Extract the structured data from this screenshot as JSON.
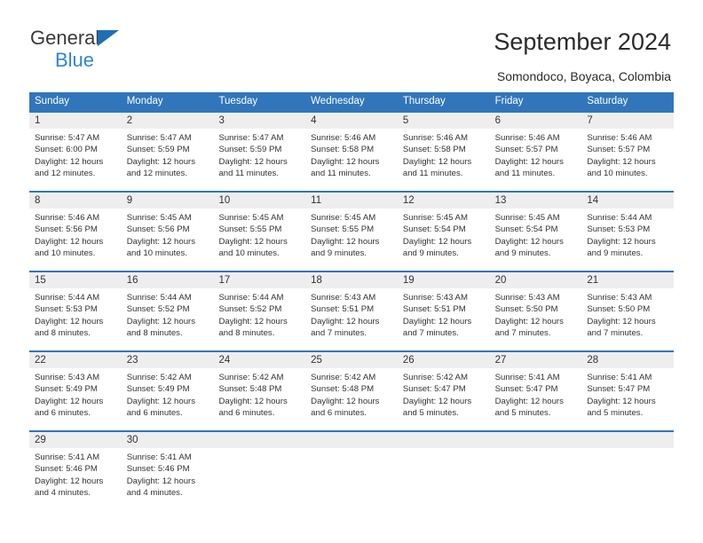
{
  "brand": {
    "name_top": "General",
    "name_bottom": "Blue",
    "accent_color": "#2f86d6",
    "triangle_color": "#1f6fb5"
  },
  "header": {
    "title": "September 2024",
    "subtitle": "Somondoco, Boyaca, Colombia"
  },
  "calendar": {
    "header_bg": "#3176ba",
    "row_border_color": "#3176ba",
    "day_number_bg": "#eeeeee",
    "weekdays": [
      "Sunday",
      "Monday",
      "Tuesday",
      "Wednesday",
      "Thursday",
      "Friday",
      "Saturday"
    ],
    "weeks": [
      [
        {
          "day": "1",
          "sunrise": "Sunrise: 5:47 AM",
          "sunset": "Sunset: 6:00 PM",
          "daylight_1": "Daylight: 12 hours",
          "daylight_2": "and 12 minutes."
        },
        {
          "day": "2",
          "sunrise": "Sunrise: 5:47 AM",
          "sunset": "Sunset: 5:59 PM",
          "daylight_1": "Daylight: 12 hours",
          "daylight_2": "and 12 minutes."
        },
        {
          "day": "3",
          "sunrise": "Sunrise: 5:47 AM",
          "sunset": "Sunset: 5:59 PM",
          "daylight_1": "Daylight: 12 hours",
          "daylight_2": "and 11 minutes."
        },
        {
          "day": "4",
          "sunrise": "Sunrise: 5:46 AM",
          "sunset": "Sunset: 5:58 PM",
          "daylight_1": "Daylight: 12 hours",
          "daylight_2": "and 11 minutes."
        },
        {
          "day": "5",
          "sunrise": "Sunrise: 5:46 AM",
          "sunset": "Sunset: 5:58 PM",
          "daylight_1": "Daylight: 12 hours",
          "daylight_2": "and 11 minutes."
        },
        {
          "day": "6",
          "sunrise": "Sunrise: 5:46 AM",
          "sunset": "Sunset: 5:57 PM",
          "daylight_1": "Daylight: 12 hours",
          "daylight_2": "and 11 minutes."
        },
        {
          "day": "7",
          "sunrise": "Sunrise: 5:46 AM",
          "sunset": "Sunset: 5:57 PM",
          "daylight_1": "Daylight: 12 hours",
          "daylight_2": "and 10 minutes."
        }
      ],
      [
        {
          "day": "8",
          "sunrise": "Sunrise: 5:46 AM",
          "sunset": "Sunset: 5:56 PM",
          "daylight_1": "Daylight: 12 hours",
          "daylight_2": "and 10 minutes."
        },
        {
          "day": "9",
          "sunrise": "Sunrise: 5:45 AM",
          "sunset": "Sunset: 5:56 PM",
          "daylight_1": "Daylight: 12 hours",
          "daylight_2": "and 10 minutes."
        },
        {
          "day": "10",
          "sunrise": "Sunrise: 5:45 AM",
          "sunset": "Sunset: 5:55 PM",
          "daylight_1": "Daylight: 12 hours",
          "daylight_2": "and 10 minutes."
        },
        {
          "day": "11",
          "sunrise": "Sunrise: 5:45 AM",
          "sunset": "Sunset: 5:55 PM",
          "daylight_1": "Daylight: 12 hours",
          "daylight_2": "and 9 minutes."
        },
        {
          "day": "12",
          "sunrise": "Sunrise: 5:45 AM",
          "sunset": "Sunset: 5:54 PM",
          "daylight_1": "Daylight: 12 hours",
          "daylight_2": "and 9 minutes."
        },
        {
          "day": "13",
          "sunrise": "Sunrise: 5:45 AM",
          "sunset": "Sunset: 5:54 PM",
          "daylight_1": "Daylight: 12 hours",
          "daylight_2": "and 9 minutes."
        },
        {
          "day": "14",
          "sunrise": "Sunrise: 5:44 AM",
          "sunset": "Sunset: 5:53 PM",
          "daylight_1": "Daylight: 12 hours",
          "daylight_2": "and 9 minutes."
        }
      ],
      [
        {
          "day": "15",
          "sunrise": "Sunrise: 5:44 AM",
          "sunset": "Sunset: 5:53 PM",
          "daylight_1": "Daylight: 12 hours",
          "daylight_2": "and 8 minutes."
        },
        {
          "day": "16",
          "sunrise": "Sunrise: 5:44 AM",
          "sunset": "Sunset: 5:52 PM",
          "daylight_1": "Daylight: 12 hours",
          "daylight_2": "and 8 minutes."
        },
        {
          "day": "17",
          "sunrise": "Sunrise: 5:44 AM",
          "sunset": "Sunset: 5:52 PM",
          "daylight_1": "Daylight: 12 hours",
          "daylight_2": "and 8 minutes."
        },
        {
          "day": "18",
          "sunrise": "Sunrise: 5:43 AM",
          "sunset": "Sunset: 5:51 PM",
          "daylight_1": "Daylight: 12 hours",
          "daylight_2": "and 7 minutes."
        },
        {
          "day": "19",
          "sunrise": "Sunrise: 5:43 AM",
          "sunset": "Sunset: 5:51 PM",
          "daylight_1": "Daylight: 12 hours",
          "daylight_2": "and 7 minutes."
        },
        {
          "day": "20",
          "sunrise": "Sunrise: 5:43 AM",
          "sunset": "Sunset: 5:50 PM",
          "daylight_1": "Daylight: 12 hours",
          "daylight_2": "and 7 minutes."
        },
        {
          "day": "21",
          "sunrise": "Sunrise: 5:43 AM",
          "sunset": "Sunset: 5:50 PM",
          "daylight_1": "Daylight: 12 hours",
          "daylight_2": "and 7 minutes."
        }
      ],
      [
        {
          "day": "22",
          "sunrise": "Sunrise: 5:43 AM",
          "sunset": "Sunset: 5:49 PM",
          "daylight_1": "Daylight: 12 hours",
          "daylight_2": "and 6 minutes."
        },
        {
          "day": "23",
          "sunrise": "Sunrise: 5:42 AM",
          "sunset": "Sunset: 5:49 PM",
          "daylight_1": "Daylight: 12 hours",
          "daylight_2": "and 6 minutes."
        },
        {
          "day": "24",
          "sunrise": "Sunrise: 5:42 AM",
          "sunset": "Sunset: 5:48 PM",
          "daylight_1": "Daylight: 12 hours",
          "daylight_2": "and 6 minutes."
        },
        {
          "day": "25",
          "sunrise": "Sunrise: 5:42 AM",
          "sunset": "Sunset: 5:48 PM",
          "daylight_1": "Daylight: 12 hours",
          "daylight_2": "and 6 minutes."
        },
        {
          "day": "26",
          "sunrise": "Sunrise: 5:42 AM",
          "sunset": "Sunset: 5:47 PM",
          "daylight_1": "Daylight: 12 hours",
          "daylight_2": "and 5 minutes."
        },
        {
          "day": "27",
          "sunrise": "Sunrise: 5:41 AM",
          "sunset": "Sunset: 5:47 PM",
          "daylight_1": "Daylight: 12 hours",
          "daylight_2": "and 5 minutes."
        },
        {
          "day": "28",
          "sunrise": "Sunrise: 5:41 AM",
          "sunset": "Sunset: 5:47 PM",
          "daylight_1": "Daylight: 12 hours",
          "daylight_2": "and 5 minutes."
        }
      ],
      [
        {
          "day": "29",
          "sunrise": "Sunrise: 5:41 AM",
          "sunset": "Sunset: 5:46 PM",
          "daylight_1": "Daylight: 12 hours",
          "daylight_2": "and 4 minutes."
        },
        {
          "day": "30",
          "sunrise": "Sunrise: 5:41 AM",
          "sunset": "Sunset: 5:46 PM",
          "daylight_1": "Daylight: 12 hours",
          "daylight_2": "and 4 minutes."
        },
        {
          "day": "",
          "sunrise": "",
          "sunset": "",
          "daylight_1": "",
          "daylight_2": ""
        },
        {
          "day": "",
          "sunrise": "",
          "sunset": "",
          "daylight_1": "",
          "daylight_2": ""
        },
        {
          "day": "",
          "sunrise": "",
          "sunset": "",
          "daylight_1": "",
          "daylight_2": ""
        },
        {
          "day": "",
          "sunrise": "",
          "sunset": "",
          "daylight_1": "",
          "daylight_2": ""
        },
        {
          "day": "",
          "sunrise": "",
          "sunset": "",
          "daylight_1": "",
          "daylight_2": ""
        }
      ]
    ]
  }
}
